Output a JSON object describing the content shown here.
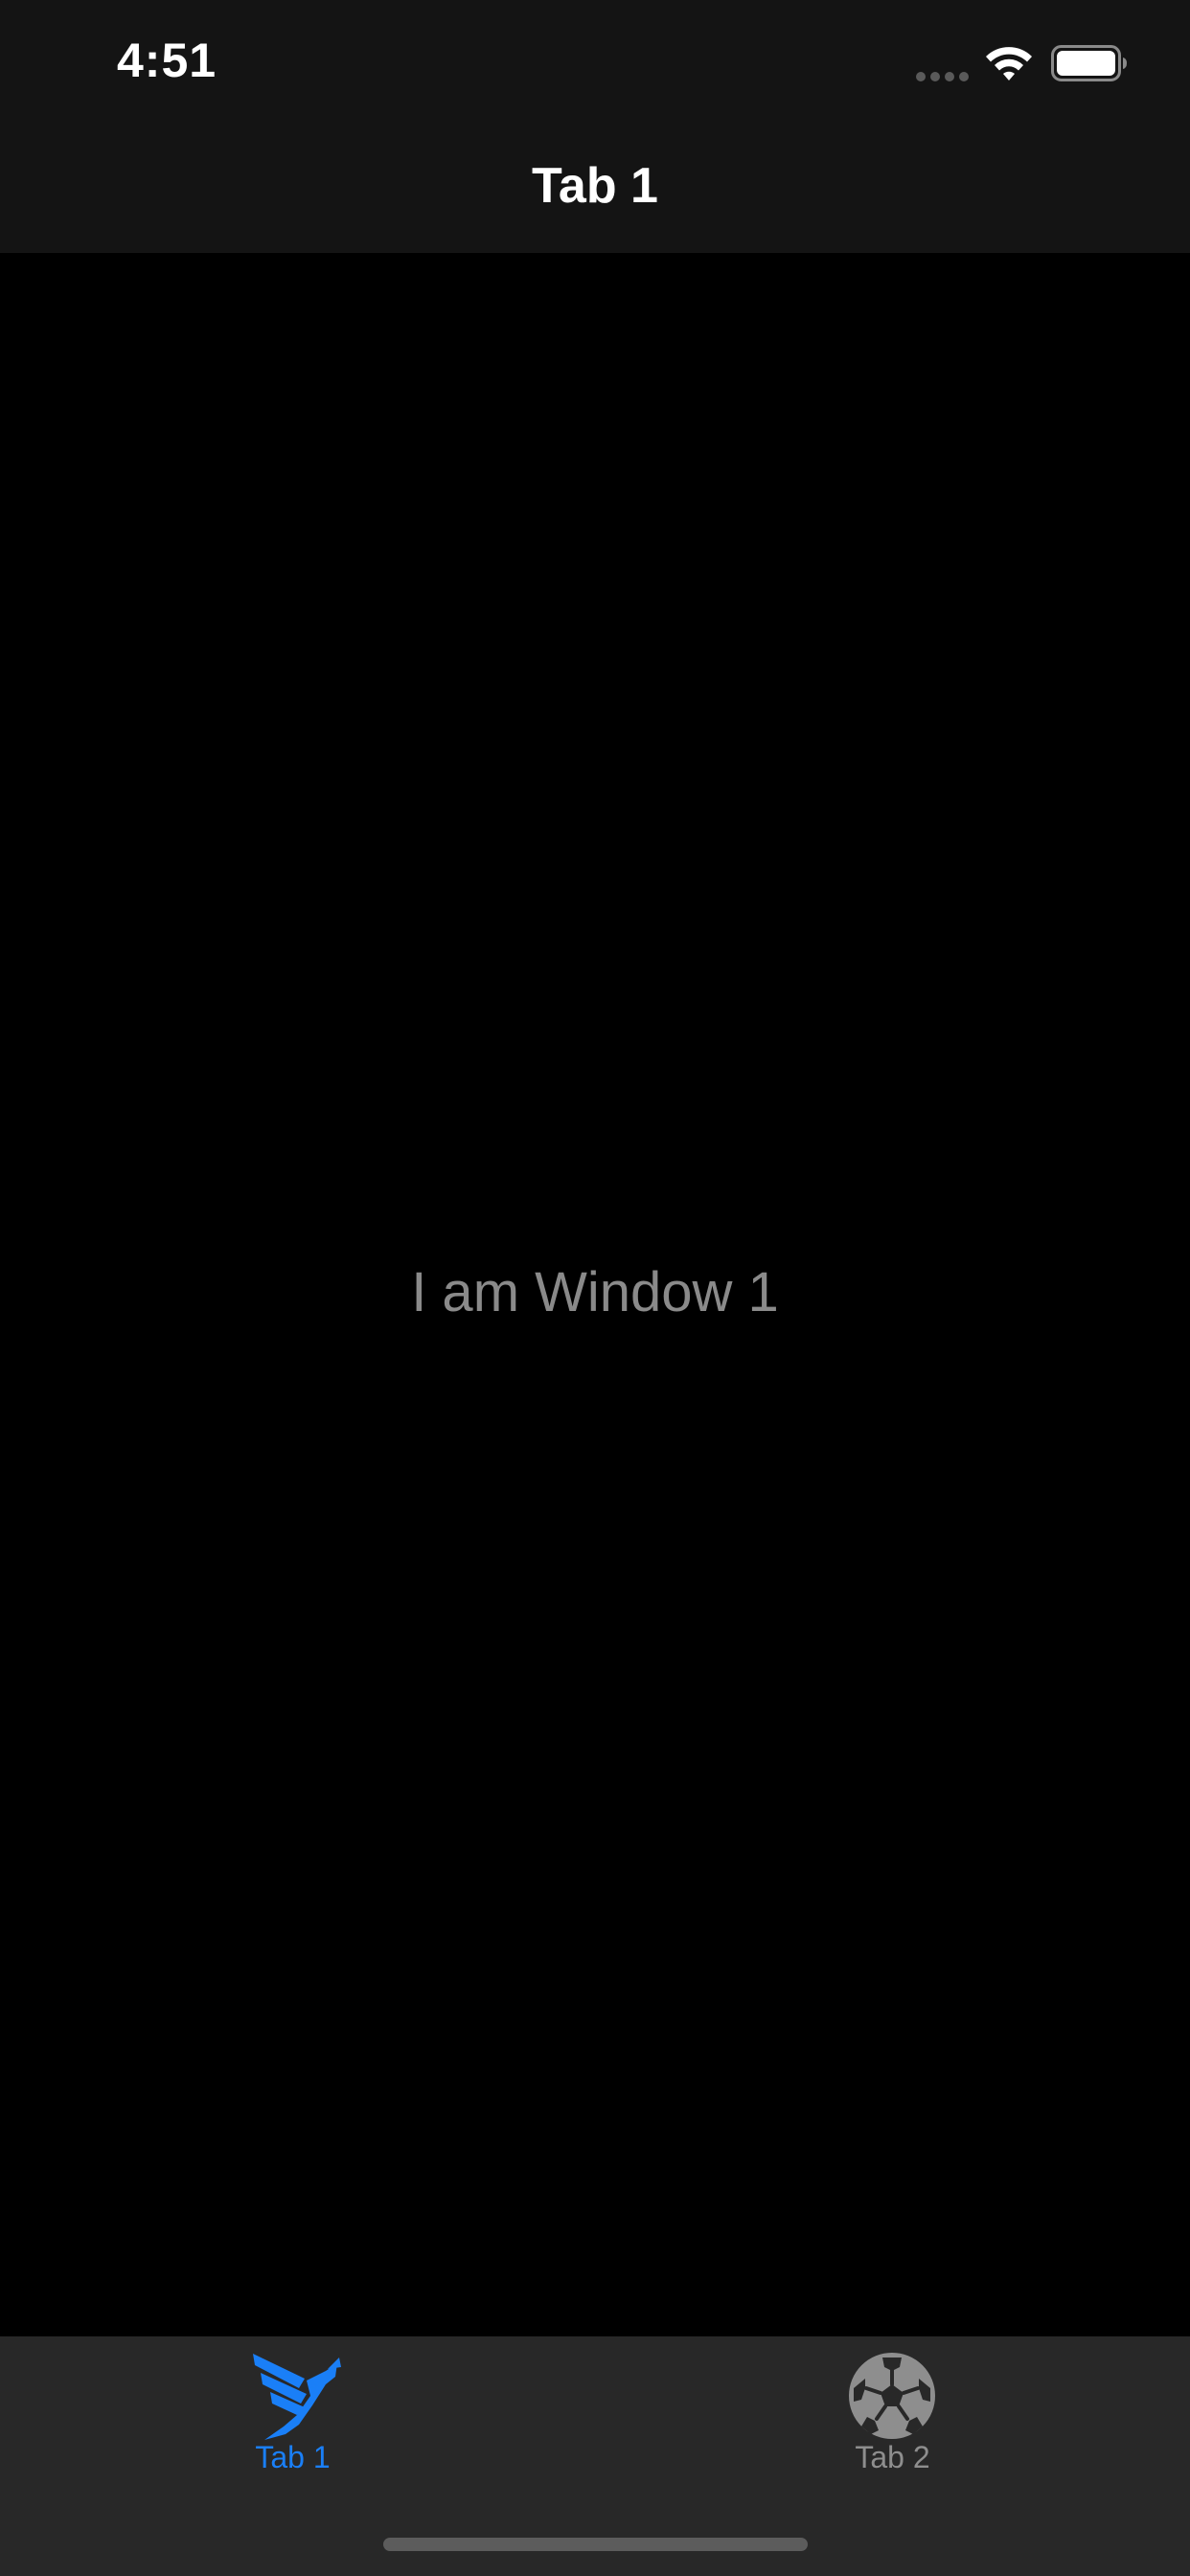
{
  "status_bar": {
    "time": "4:51"
  },
  "nav_bar": {
    "title": "Tab 1"
  },
  "content": {
    "label": "I am Window 1"
  },
  "tab_bar": {
    "tabs": [
      {
        "label": "Tab 1",
        "icon": "bird-logo-icon",
        "selected": true
      },
      {
        "label": "Tab 2",
        "icon": "soccer-ball-icon",
        "selected": false
      }
    ]
  },
  "colors": {
    "header_background": "#141414",
    "content_background": "#000000",
    "tab_bar_background": "#282828",
    "active_tint": "#1a7ff7",
    "inactive_tint": "#8e8e8e",
    "content_text": "#8a8a8a",
    "title_text": "#ffffff"
  }
}
